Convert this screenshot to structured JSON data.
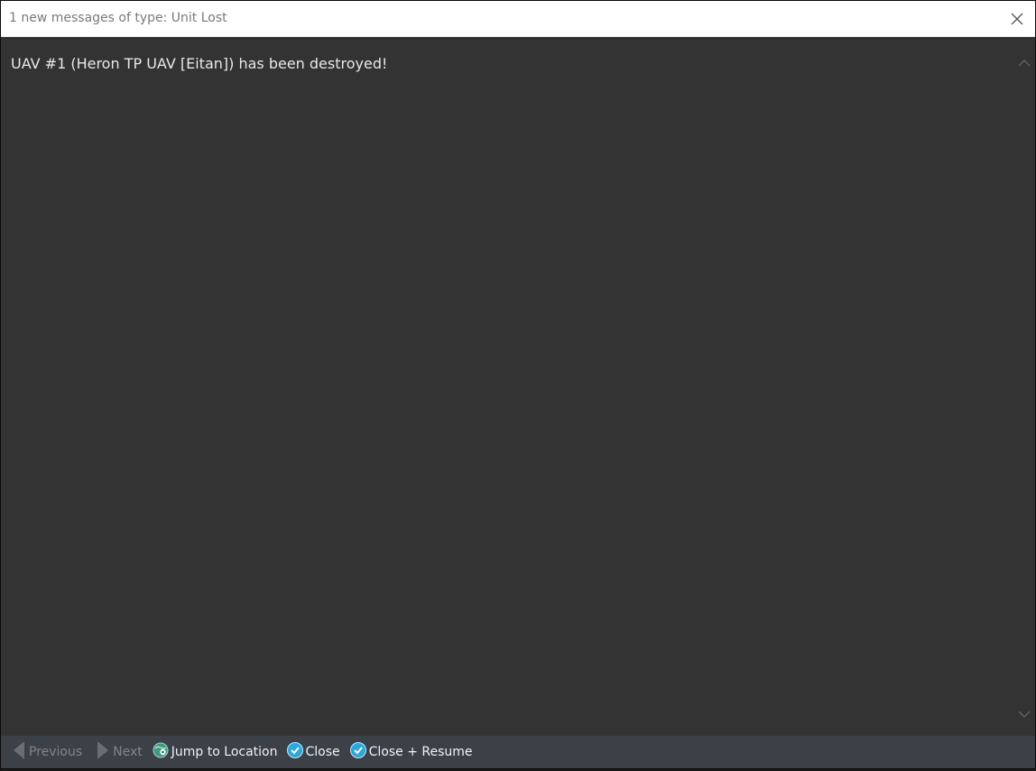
{
  "window": {
    "title": "1 new messages of type: Unit Lost",
    "close_icon": "close-icon"
  },
  "message": {
    "text": "UAV #1 (Heron TP UAV [Eitan]) has been destroyed!"
  },
  "toolbar": {
    "previous_label": "Previous",
    "next_label": "Next",
    "jump_label": "Jump to Location",
    "close_label": "Close",
    "close_resume_label": "Close + Resume"
  },
  "colors": {
    "accent": "#29a8e0",
    "content_bg": "#333333",
    "toolbar_bg": "#3c4147"
  }
}
